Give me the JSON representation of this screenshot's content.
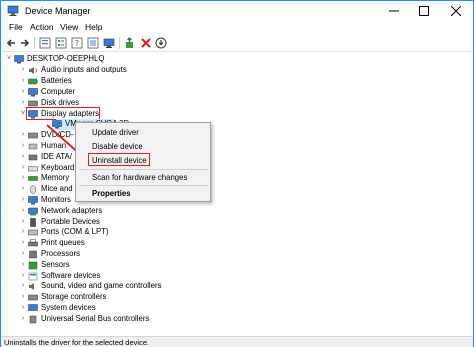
{
  "window": {
    "title": "Device Manager"
  },
  "menu": [
    "File",
    "Action",
    "View",
    "Help"
  ],
  "tree": {
    "root": "DESKTOP-OEEPHLQ",
    "items": [
      "Audio inputs and outputs",
      "Batteries",
      "Computer",
      "Disk drives",
      "Display adapters",
      "VMware SVGA 3D",
      "DVD/CD-ROM drives",
      "Human Interface Devices",
      "IDE ATA/ATAPI controllers",
      "Keyboards",
      "Memory technology devices",
      "Mice and other pointing devices",
      "Monitors",
      "Network adapters",
      "Portable Devices",
      "Ports (COM & LPT)",
      "Print queues",
      "Processors",
      "Sensors",
      "Software devices",
      "Sound, video and game controllers",
      "Storage controllers",
      "System devices",
      "Universal Serial Bus controllers"
    ],
    "truncated": {
      "dvd": "DVD/CD-",
      "human": "Human",
      "ide": "IDE ATA/",
      "keyboard": "Keyboard",
      "memory": "Memory",
      "mice": "Mice and",
      "vmware": "VMware SVGA 3D"
    }
  },
  "context_menu": {
    "items": [
      "Update driver",
      "Disable device",
      "Uninstall device",
      "Scan for hardware changes",
      "Properties"
    ]
  },
  "status": {
    "text": "Uninstalls the driver for the selected device."
  },
  "colors": {
    "highlight": "#e02020",
    "accent": "#1e90ff"
  }
}
